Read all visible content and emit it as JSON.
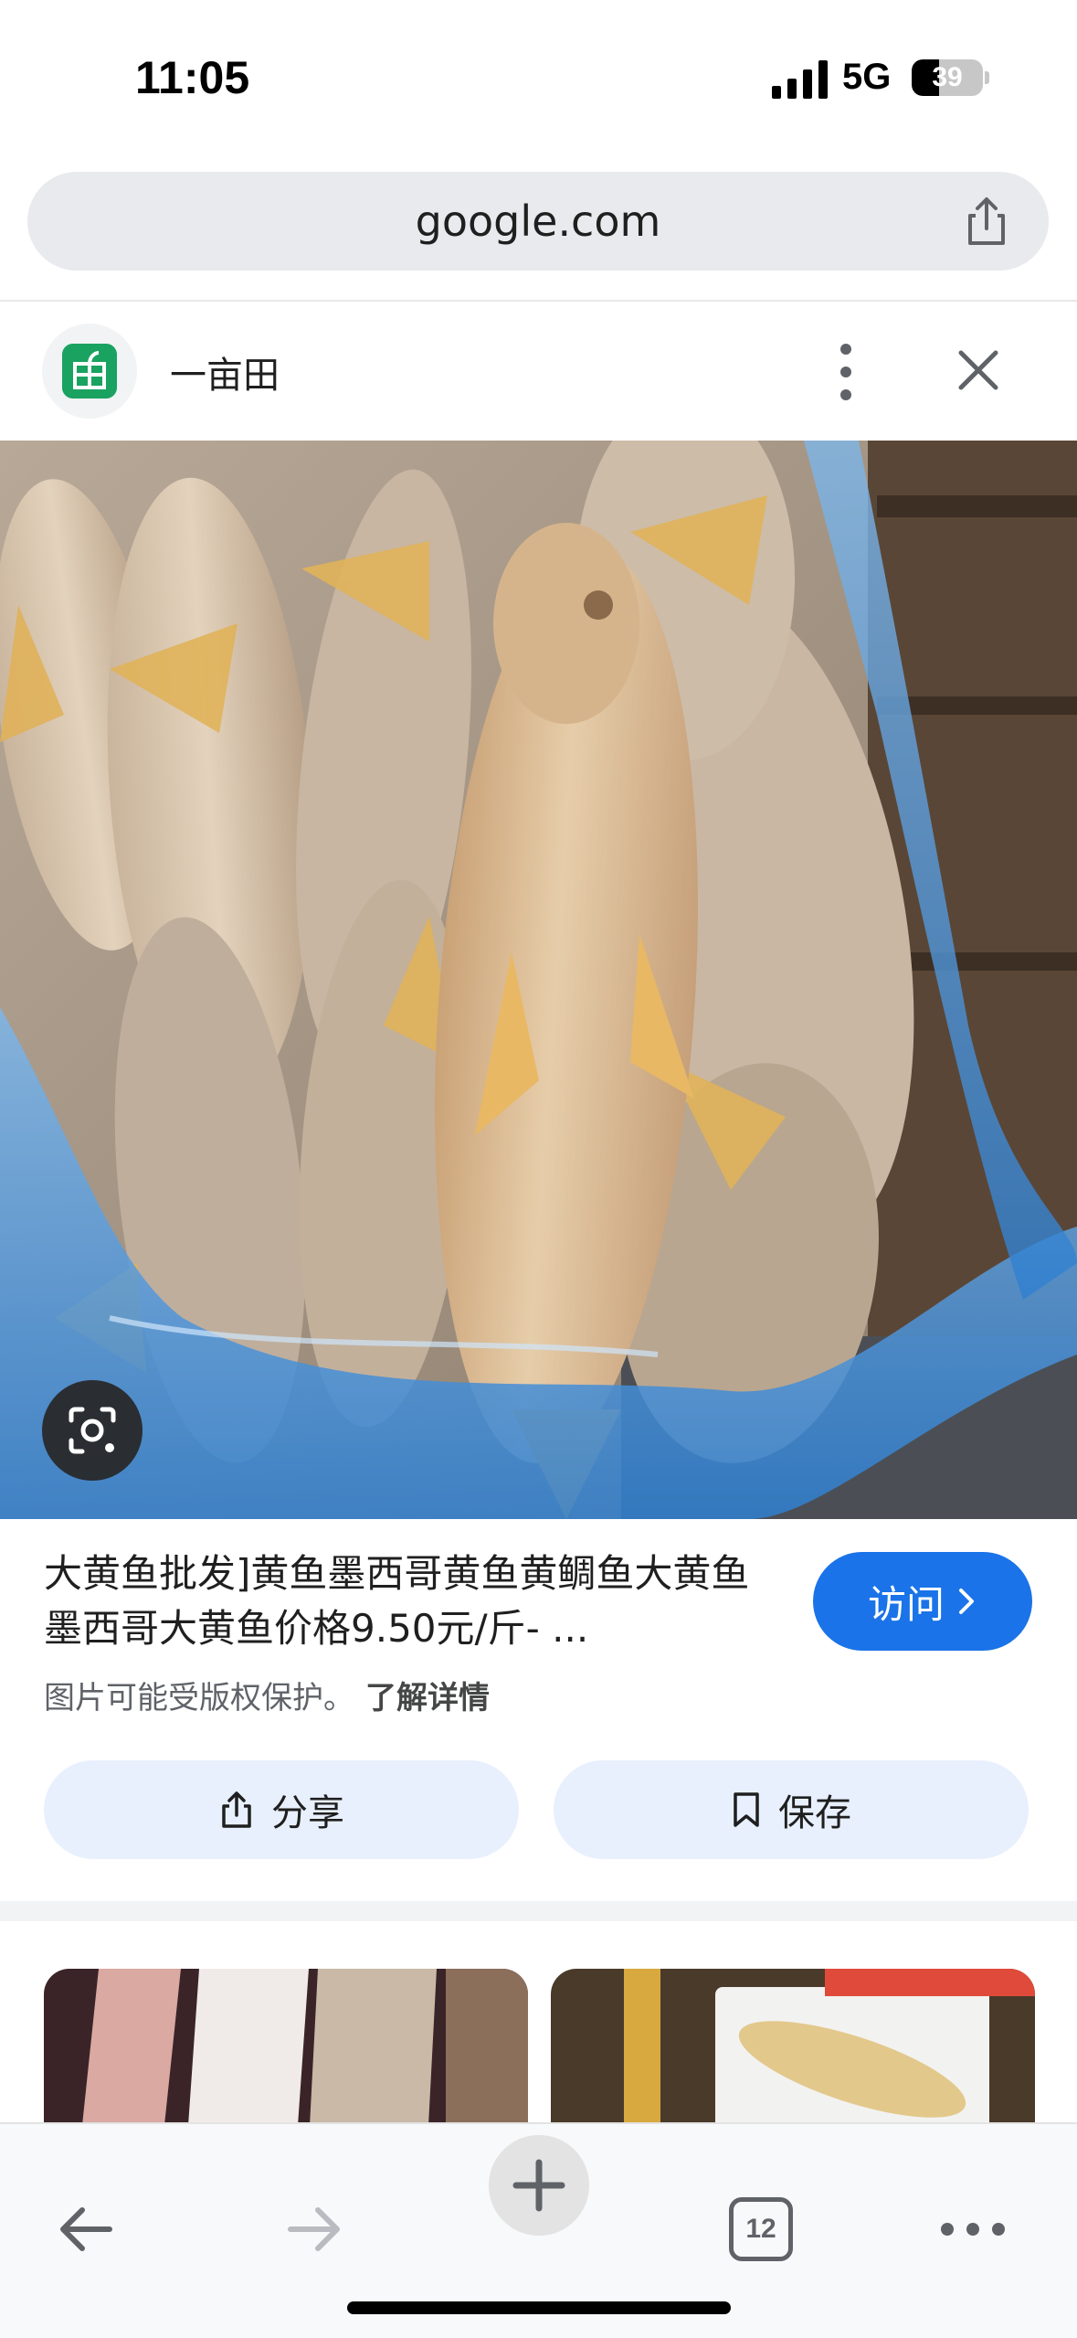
{
  "status_bar": {
    "time": "11:05",
    "network": "5G",
    "battery_percent": 39,
    "battery_text": "39"
  },
  "url_bar": {
    "url": "google.com",
    "share_icon": "share-icon"
  },
  "source": {
    "name": "一亩田",
    "logo_color": "#1aa260"
  },
  "result": {
    "title": "大黄鱼批发]黄鱼墨西哥黄鱼黄鲷鱼大黄鱼墨西哥大黄鱼价格9.50元/斤- ...",
    "visit_label": "访问",
    "copyright_notice": "图片可能受版权保护。",
    "learn_more": "了解详情",
    "share_label": "分享",
    "save_label": "保存"
  },
  "toolbar": {
    "tab_count": "12"
  },
  "colors": {
    "accent": "#1a73e8",
    "pill_bg": "#e8f0fe",
    "urlbar_bg": "#e8eaed"
  }
}
